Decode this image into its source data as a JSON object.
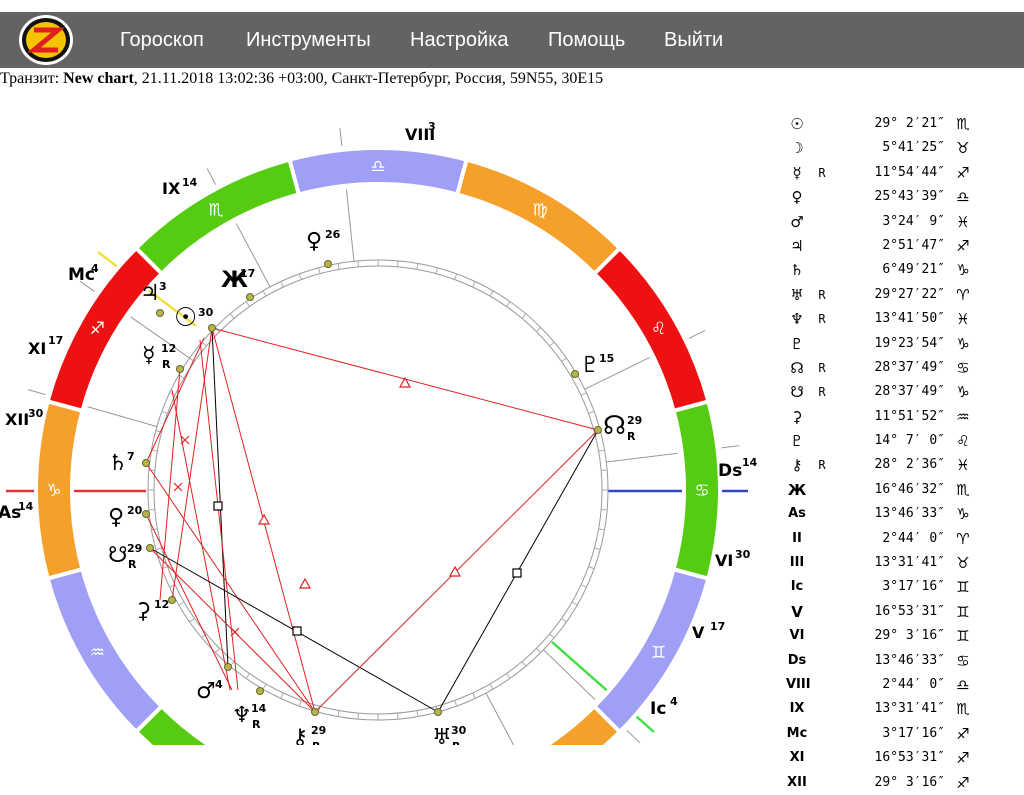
{
  "nav": {
    "logo_letter": "S",
    "items": [
      "Гороскоп",
      "Инструменты",
      "Настройка",
      "Помощь",
      "Выйти"
    ]
  },
  "info": {
    "prefix": "Транзит: ",
    "chart_name": "New chart",
    "details": ", 21.11.2018 13:02:36 +03:00, Санкт-Петербург, Россия, 59N55, 30E15"
  },
  "colors": {
    "fire": "#ee1111",
    "earth": "#f5a02a",
    "air": "#9f9ff5",
    "water": "#55cc11",
    "nav_bg": "#636363",
    "aspect_red": "#dd2222",
    "aspect_black": "#000000"
  },
  "signs": [
    {
      "name": "aries",
      "glyph": "♈"
    },
    {
      "name": "taurus",
      "glyph": "♉"
    },
    {
      "name": "gemini",
      "glyph": "♊"
    },
    {
      "name": "cancer",
      "glyph": "♋"
    },
    {
      "name": "leo",
      "glyph": "♌"
    },
    {
      "name": "virgo",
      "glyph": "♍"
    },
    {
      "name": "libra",
      "glyph": "♎"
    },
    {
      "name": "scorpio",
      "glyph": "♏"
    },
    {
      "name": "sagittarius",
      "glyph": "♐"
    },
    {
      "name": "capricorn",
      "glyph": "♑"
    },
    {
      "name": "aquarius",
      "glyph": "♒"
    },
    {
      "name": "pisces",
      "glyph": "♓"
    }
  ],
  "axes": {
    "asc": "As",
    "asc_deg": "14",
    "dsc": "Ds",
    "dsc_deg": "14",
    "mc": "Mc",
    "mc_deg": "4",
    "ic": "Ic",
    "ic_deg": "4"
  },
  "houses": [
    {
      "label": "VIII",
      "deg": "3"
    },
    {
      "label": "IX",
      "deg": "14"
    },
    {
      "label": "XI",
      "deg": "17"
    },
    {
      "label": "XII",
      "deg": "30"
    },
    {
      "label": "VI",
      "deg": "30"
    },
    {
      "label": "V",
      "deg": "17"
    }
  ],
  "wheel_planets": [
    {
      "name": "sun",
      "glyph": "☉",
      "deg": "30",
      "retro": ""
    },
    {
      "name": "jupiter",
      "glyph": "♃",
      "deg": "3",
      "retro": ""
    },
    {
      "name": "venus",
      "glyph": "♀",
      "deg": "26",
      "retro": ""
    },
    {
      "name": "vertex",
      "glyph": "Ж",
      "deg": "17",
      "retro": ""
    },
    {
      "name": "mercury",
      "glyph": "☿",
      "deg": "12",
      "retro": "R"
    },
    {
      "name": "saturn",
      "glyph": "♄",
      "deg": "7",
      "retro": ""
    },
    {
      "name": "pluto",
      "glyph": "♀",
      "deg": "20",
      "retro": ""
    },
    {
      "name": "south-node",
      "glyph": "☋",
      "deg": "29",
      "retro": "R"
    },
    {
      "name": "ceres",
      "glyph": "⚳",
      "deg": "12",
      "retro": ""
    },
    {
      "name": "mars",
      "glyph": "♂",
      "deg": "4",
      "retro": ""
    },
    {
      "name": "neptune",
      "glyph": "♆",
      "deg": "14",
      "retro": "R"
    },
    {
      "name": "chiron",
      "glyph": "⚷",
      "deg": "29",
      "retro": "R"
    },
    {
      "name": "uranus",
      "glyph": "♅",
      "deg": "30",
      "retro": "R"
    },
    {
      "name": "north-node",
      "glyph": "☊",
      "deg": "29",
      "retro": "R"
    },
    {
      "name": "proserpina",
      "glyph": "♇",
      "deg": "15",
      "retro": ""
    }
  ],
  "positions": [
    {
      "glyph": "☉",
      "retro": "",
      "pos": "29° 2′21″",
      "sign": "♏"
    },
    {
      "glyph": "☽",
      "retro": "",
      "pos": "5°41′25″",
      "sign": "♉"
    },
    {
      "glyph": "☿",
      "retro": "R",
      "pos": "11°54′44″",
      "sign": "♐"
    },
    {
      "glyph": "♀",
      "retro": "",
      "pos": "25°43′39″",
      "sign": "♎"
    },
    {
      "glyph": "♂",
      "retro": "",
      "pos": "3°24′ 9″",
      "sign": "♓"
    },
    {
      "glyph": "♃",
      "retro": "",
      "pos": "2°51′47″",
      "sign": "♐"
    },
    {
      "glyph": "♄",
      "retro": "",
      "pos": "6°49′21″",
      "sign": "♑"
    },
    {
      "glyph": "♅",
      "retro": "R",
      "pos": "29°27′22″",
      "sign": "♈"
    },
    {
      "glyph": "♆",
      "retro": "R",
      "pos": "13°41′50″",
      "sign": "♓"
    },
    {
      "glyph": "♇",
      "retro": "",
      "pos": "19°23′54″",
      "sign": "♑"
    },
    {
      "glyph": "☊",
      "retro": "R",
      "pos": "28°37′49″",
      "sign": "♋"
    },
    {
      "glyph": "☋",
      "retro": "R",
      "pos": "28°37′49″",
      "sign": "♑"
    },
    {
      "glyph": "⚳",
      "retro": "",
      "pos": "11°51′52″",
      "sign": "♒"
    },
    {
      "glyph": "♇",
      "retro": "",
      "pos": "14° 7′ 0″",
      "sign": "♌"
    },
    {
      "glyph": "⚷",
      "retro": "R",
      "pos": "28° 2′36″",
      "sign": "♓"
    },
    {
      "glyph": "Ж",
      "retro": "",
      "pos": "16°46′32″",
      "sign": "♏"
    },
    {
      "glyph": "As",
      "retro": "",
      "pos": "13°46′33″",
      "sign": "♑"
    },
    {
      "glyph": "II",
      "retro": "",
      "pos": "2°44′ 0″",
      "sign": "♈"
    },
    {
      "glyph": "III",
      "retro": "",
      "pos": "13°31′41″",
      "sign": "♉"
    },
    {
      "glyph": "Ic",
      "retro": "",
      "pos": "3°17′16″",
      "sign": "♊"
    },
    {
      "glyph": "V",
      "retro": "",
      "pos": "16°53′31″",
      "sign": "♊"
    },
    {
      "glyph": "VI",
      "retro": "",
      "pos": "29° 3′16″",
      "sign": "♊"
    },
    {
      "glyph": "Ds",
      "retro": "",
      "pos": "13°46′33″",
      "sign": "♋"
    },
    {
      "glyph": "VIII",
      "retro": "",
      "pos": "2°44′ 0″",
      "sign": "♎"
    },
    {
      "glyph": "IX",
      "retro": "",
      "pos": "13°31′41″",
      "sign": "♏"
    },
    {
      "glyph": "Mc",
      "retro": "",
      "pos": "3°17′16″",
      "sign": "♐"
    },
    {
      "glyph": "XI",
      "retro": "",
      "pos": "16°53′31″",
      "sign": "♐"
    },
    {
      "glyph": "XII",
      "retro": "",
      "pos": "29° 3′16″",
      "sign": "♐"
    }
  ]
}
